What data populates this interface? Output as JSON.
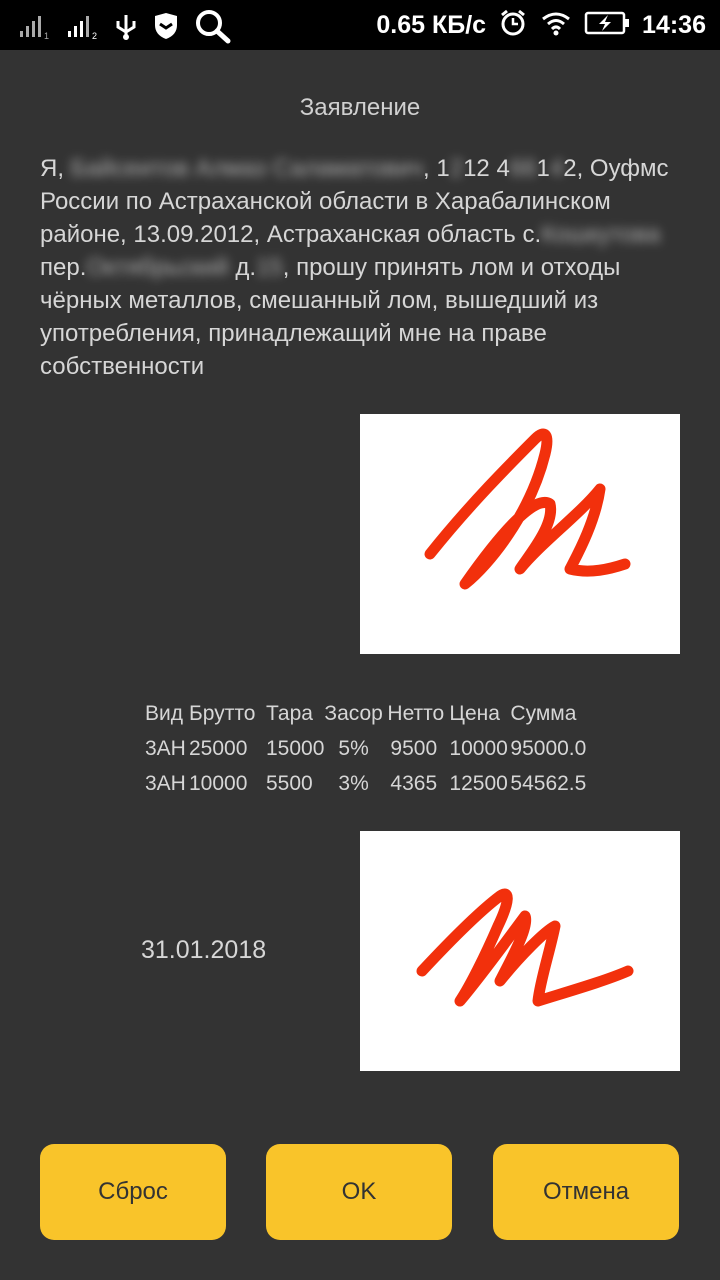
{
  "status_bar": {
    "speed": "0.65 КБ/с",
    "time": "14:36",
    "icons": [
      "signal-1-icon",
      "signal-2-icon",
      "usb-icon",
      "shield-icon",
      "search-icon",
      "alarm-icon",
      "wifi-icon",
      "battery-charging-icon"
    ]
  },
  "document": {
    "title": "Заявление",
    "statement": {
      "p1": "Я, ",
      "name_redacted": "Байсеитов Алмаз Саламатович",
      "p2": ", 1",
      "r1": "2",
      "p3": "12 4",
      "r2": "66",
      "p4": "1",
      "r3": "4",
      "p5": "2, Оуфмс России по Астраханской области в Харабалинском районе, 13.09.2012, Астраханская область с.",
      "village_redacted": "Кошкутова",
      "p6": " пер.",
      "street_redacted": "Октябрьский",
      "p7": " д.",
      "house_redacted": "15",
      "p8": ", прошу принять лом и отходы чёрных металлов, смешанный лом, вышедший из употребления, принадлежащий мне на праве собственности"
    }
  },
  "table": {
    "headers": [
      "Вид",
      "Брутто",
      "Тара",
      "Засор",
      "Нетто",
      "Цена",
      "Сумма"
    ],
    "rows": [
      [
        "3АН",
        "25000",
        "15000",
        "5%",
        "9500",
        "10000",
        "95000.0"
      ],
      [
        "3АН",
        "10000",
        "5500",
        "3%",
        "4365",
        "12500",
        "54562.5"
      ]
    ]
  },
  "date": "31.01.2018",
  "signature_color": "#f2300c",
  "accent_color": "#f9c42a",
  "buttons": {
    "reset": "Сброс",
    "ok": "OK",
    "cancel": "Отмена"
  }
}
